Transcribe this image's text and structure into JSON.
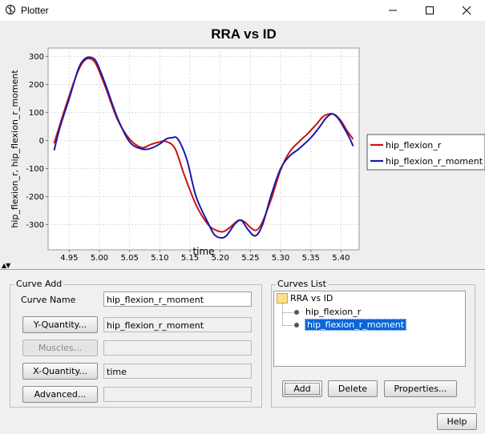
{
  "window": {
    "title": "Plotter"
  },
  "chart_data": {
    "type": "line",
    "title": "RRA vs ID",
    "xlabel": "time",
    "ylabel": "hip_flexion_r, hip_flexion_r_moment",
    "xlim": [
      4.915,
      5.43
    ],
    "ylim": [
      -390,
      330
    ],
    "xticks": [
      4.95,
      5.0,
      5.05,
      5.1,
      5.15,
      5.2,
      5.25,
      5.3,
      5.35,
      5.4
    ],
    "xtick_labels": [
      "4.95",
      "5.00",
      "5.05",
      "5.10",
      "5.15",
      "5.20",
      "5.25",
      "5.30",
      "5.35",
      "5.40"
    ],
    "yticks": [
      300,
      200,
      100,
      0,
      -100,
      -200,
      -300
    ],
    "ytick_labels": [
      "300",
      "200",
      "100",
      "0",
      "-100",
      "-200",
      "-300"
    ],
    "grid": true,
    "legend_position": "right",
    "series": [
      {
        "name": "hip_flexion_r",
        "color": "#cc1111",
        "x": [
          4.925,
          4.935,
          4.95,
          4.965,
          4.975,
          4.985,
          4.995,
          5.01,
          5.03,
          5.05,
          5.07,
          5.085,
          5.1,
          5.11,
          5.125,
          5.14,
          5.16,
          5.18,
          5.195,
          5.205,
          5.215,
          5.23,
          5.24,
          5.25,
          5.26,
          5.27,
          5.285,
          5.3,
          5.315,
          5.33,
          5.345,
          5.36,
          5.37,
          5.38,
          5.39,
          5.4,
          5.41,
          5.42
        ],
        "y": [
          -10,
          60,
          160,
          250,
          285,
          292,
          270,
          190,
          75,
          5,
          -25,
          -14,
          -5,
          -3,
          -28,
          -120,
          -230,
          -300,
          -322,
          -325,
          -312,
          -285,
          -290,
          -310,
          -320,
          -290,
          -205,
          -105,
          -40,
          -5,
          25,
          60,
          85,
          95,
          92,
          70,
          35,
          5
        ]
      },
      {
        "name": "hip_flexion_r_moment",
        "color": "#1a1aaa",
        "x": [
          4.925,
          4.935,
          4.95,
          4.965,
          4.975,
          4.985,
          4.995,
          5.01,
          5.03,
          5.05,
          5.07,
          5.085,
          5.1,
          5.11,
          5.12,
          5.13,
          5.145,
          5.16,
          5.18,
          5.19,
          5.2,
          5.21,
          5.225,
          5.235,
          5.245,
          5.258,
          5.27,
          5.285,
          5.3,
          5.315,
          5.33,
          5.35,
          5.365,
          5.375,
          5.385,
          5.395,
          5.405,
          5.415,
          5.42
        ],
        "y": [
          -35,
          50,
          150,
          255,
          290,
          297,
          280,
          200,
          80,
          -5,
          -30,
          -28,
          -12,
          5,
          10,
          5,
          -70,
          -200,
          -295,
          -335,
          -347,
          -340,
          -296,
          -285,
          -315,
          -340,
          -300,
          -190,
          -100,
          -55,
          -30,
          10,
          50,
          80,
          95,
          80,
          45,
          5,
          -20
        ]
      }
    ]
  },
  "splitter": {
    "arrows": "▲▼"
  },
  "curve_add": {
    "title": "Curve Add",
    "curve_name_label": "Curve Name",
    "curve_name_value": "hip_flexion_r_moment",
    "y_quantity_button": "Y-Quantity...",
    "y_quantity_value": "hip_flexion_r_moment",
    "muscles_button": "Muscles...",
    "muscles_value": "",
    "x_quantity_button": "X-Quantity...",
    "x_quantity_value": "time",
    "advanced_button": "Advanced...",
    "advanced_value": ""
  },
  "curves_list": {
    "title": "Curves List",
    "root": "RRA vs ID",
    "items": [
      "hip_flexion_r",
      "hip_flexion_r_moment"
    ],
    "add_button": "Add",
    "delete_button": "Delete",
    "properties_button": "Properties..."
  },
  "help_button": "Help"
}
